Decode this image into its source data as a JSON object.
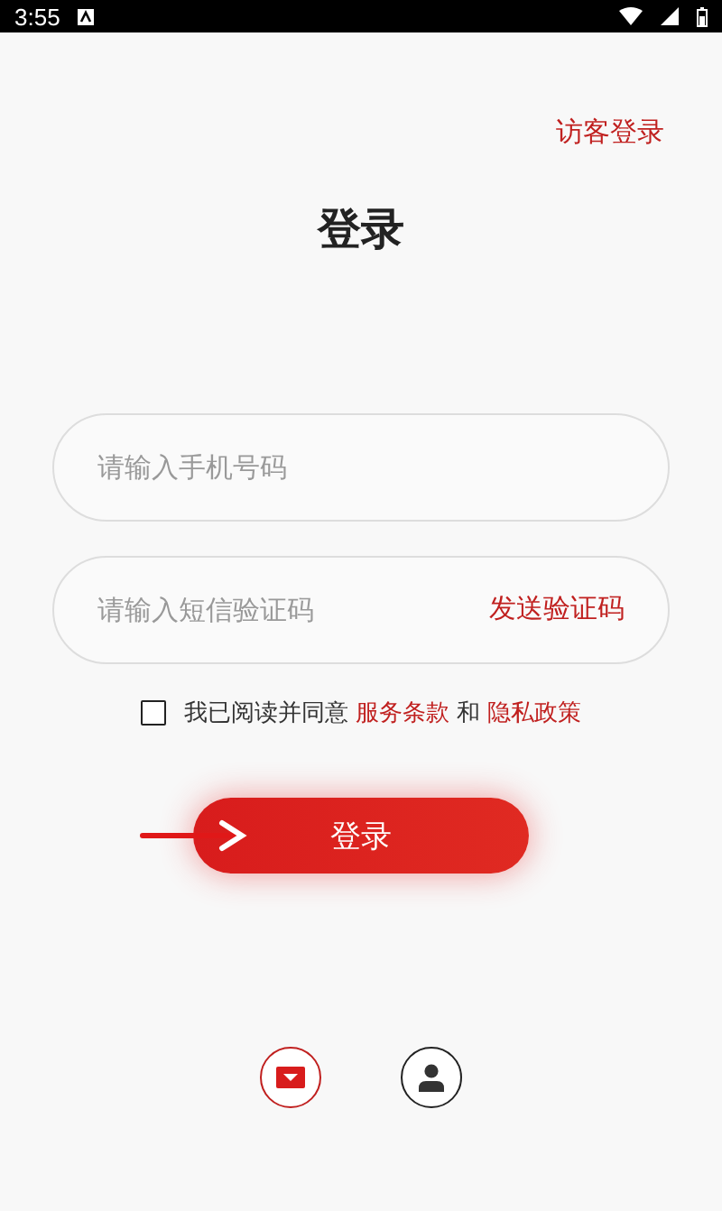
{
  "status_bar": {
    "time": "3:55"
  },
  "guest_login": "访客登录",
  "title": "登录",
  "phone_field": {
    "placeholder": "请输入手机号码"
  },
  "code_field": {
    "placeholder": "请输入短信验证码",
    "action": "发送验证码"
  },
  "agreement": {
    "checked": false,
    "text": "我已阅读并同意",
    "terms_link": "服务条款",
    "joiner": "和",
    "privacy_link": "隐私政策"
  },
  "login_button": "登录",
  "bottom_icons": [
    {
      "kind": "mail"
    },
    {
      "kind": "person"
    }
  ]
}
